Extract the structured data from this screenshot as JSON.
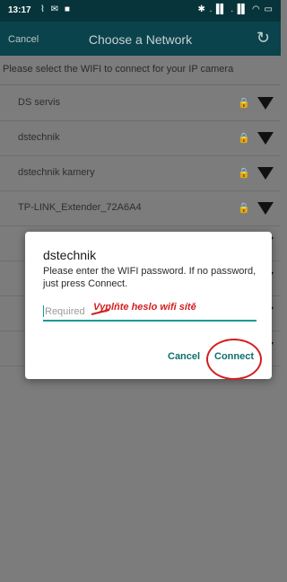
{
  "status_bar": {
    "time": "13:17",
    "left_icons": "⌇ ✉ ■",
    "right_icons": "✱ .▐▌ .▐▌ ◠ ▭"
  },
  "header": {
    "cancel_label": "Cancel",
    "title": "Choose a Network",
    "refresh_icon": "↻"
  },
  "subtitle": "Please select the WIFI to connect for your IP camera",
  "networks": [
    {
      "name": "DS servis",
      "lock": "🔒"
    },
    {
      "name": "dstechnik",
      "lock": "🔒"
    },
    {
      "name": "dstechnik kamery",
      "lock": "🔒"
    },
    {
      "name": "TP-LINK_Extender_72A6A4",
      "lock": "🔒"
    }
  ],
  "dialog": {
    "title": "dstechnik",
    "message": "Please enter the WIFI password. If no password, just press Connect.",
    "password_placeholder": "Required",
    "annotation": "Vyplňte heslo wifi sítě",
    "cancel_label": "Cancel",
    "connect_label": "Connect"
  },
  "colors": {
    "appbar": "#0a434b",
    "accent": "#129b96",
    "annotation": "#d21f1f"
  }
}
